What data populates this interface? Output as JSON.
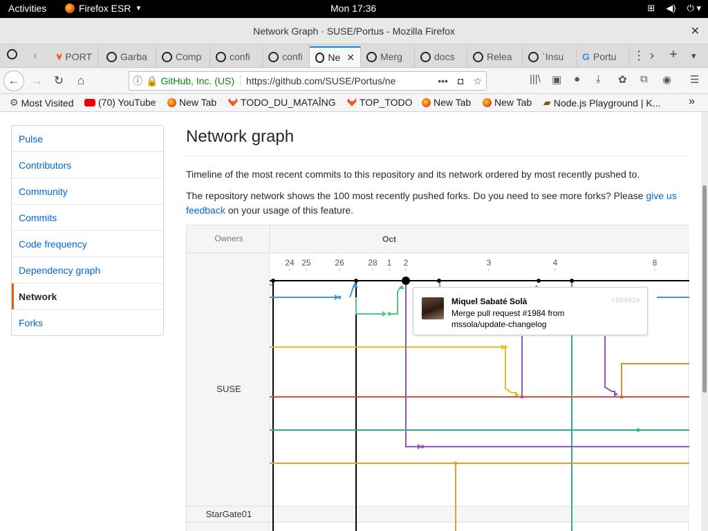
{
  "topbar": {
    "activities": "Activities",
    "app_name": "Firefox ESR",
    "clock": "Mon 17:36"
  },
  "window": {
    "title": "Network Graph · SUSE/Portus - Mozilla Firefox"
  },
  "tabs": [
    {
      "label": "PORT",
      "icon": "gitlab-icon"
    },
    {
      "label": "Garba",
      "icon": "github-icon"
    },
    {
      "label": "Comp",
      "icon": "github-icon"
    },
    {
      "label": "confi",
      "icon": "github-icon"
    },
    {
      "label": "confi",
      "icon": "github-icon"
    },
    {
      "label": "Ne",
      "icon": "github-icon",
      "active": true
    },
    {
      "label": "Merg",
      "icon": "github-icon"
    },
    {
      "label": "docs",
      "icon": "github-icon"
    },
    {
      "label": "Relea",
      "icon": "github-icon"
    },
    {
      "label": "`Insu",
      "icon": "github-icon"
    },
    {
      "label": "Portu",
      "icon": "google-icon"
    }
  ],
  "navbar": {
    "site_identity": "GitHub, Inc. (US)",
    "url": "https://github.com/SUSE/Portus/ne"
  },
  "bookmarks": [
    {
      "label": "Most Visited",
      "icon": "gear-icon"
    },
    {
      "label": "(70) YouTube",
      "icon": "youtube-icon"
    },
    {
      "label": "New Tab",
      "icon": "firefox-icon"
    },
    {
      "label": "TODO_DU_MATAÎNG",
      "icon": "gitlab-icon"
    },
    {
      "label": "TOP_TODO",
      "icon": "gitlab-icon"
    },
    {
      "label": "New Tab",
      "icon": "firefox-icon"
    },
    {
      "label": "New Tab",
      "icon": "firefox-icon"
    },
    {
      "label": "Node.js Playground | K...",
      "icon": "node-icon"
    }
  ],
  "sidebar": {
    "items": [
      {
        "label": "Pulse"
      },
      {
        "label": "Contributors"
      },
      {
        "label": "Community"
      },
      {
        "label": "Commits"
      },
      {
        "label": "Code frequency"
      },
      {
        "label": "Dependency graph"
      },
      {
        "label": "Network",
        "selected": true
      },
      {
        "label": "Forks"
      }
    ]
  },
  "main": {
    "heading": "Network graph",
    "description": "Timeline of the most recent commits to this repository and its network ordered by most recently pushed to.",
    "forks_text_before": "The repository network shows the 100 most recently pushed forks. Do you need to see more forks? Please ",
    "forks_link": "give us feedback",
    "forks_text_after": " on your usage of this feature."
  },
  "graph": {
    "owners_header": "Owners",
    "month_label": "Oct",
    "dates": [
      "24",
      "25",
      "26",
      "28",
      "1",
      "2",
      "3",
      "4",
      "8"
    ],
    "owners": [
      "SUSE",
      "StarGate01"
    ],
    "tooltip": {
      "author": "Miquel Sabaté Solà",
      "sha": "c98a51e",
      "message_line1": "Merge pull request #1984 from",
      "message_line2": "mssola/update-changelog"
    },
    "colors": {
      "black": "#000000",
      "blue": "#3f9bd8",
      "green": "#4ec97b",
      "yellow": "#e8c21a",
      "red": "#e04c3d",
      "teal": "#2aae8f",
      "purple": "#9256c2",
      "orange": "#f29b1d",
      "dark_orange": "#e8892c"
    }
  }
}
